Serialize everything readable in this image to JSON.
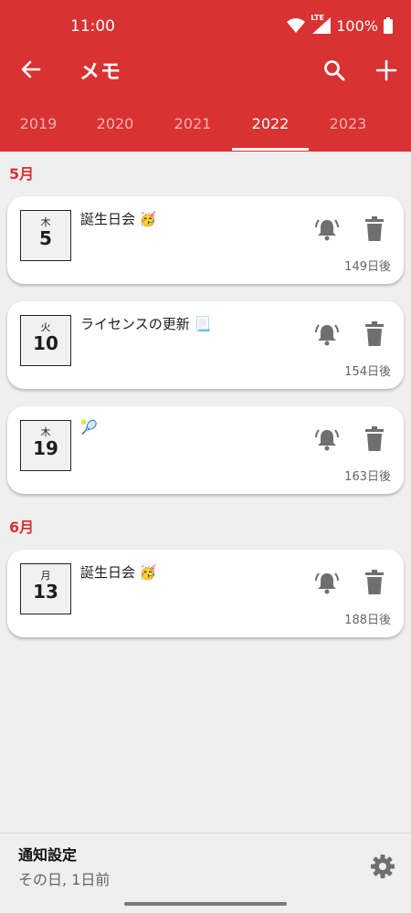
{
  "status": {
    "time": "11:00",
    "network": "LTE",
    "battery": "100%"
  },
  "toolbar": {
    "title": "メモ"
  },
  "tabs": [
    "2019",
    "2020",
    "2021",
    "2022",
    "2023"
  ],
  "active_tab": "2022",
  "groups": [
    {
      "month": "5月",
      "memos": [
        {
          "weekday": "木",
          "day": "5",
          "title": "誕生日会 🥳",
          "days": "149日後"
        },
        {
          "weekday": "火",
          "day": "10",
          "title": "ライセンスの更新 📃",
          "days": "154日後"
        },
        {
          "weekday": "木",
          "day": "19",
          "title": "🎾",
          "days": "163日後"
        }
      ]
    },
    {
      "month": "6月",
      "memos": [
        {
          "weekday": "月",
          "day": "13",
          "title": "誕生日会 🥳",
          "days": "188日後"
        }
      ]
    }
  ],
  "bottom": {
    "heading": "通知設定",
    "value": "その日, 1日前"
  },
  "colors": {
    "accent": "#d83232",
    "background": "#efeff0",
    "icon": "#6f6f6f"
  }
}
